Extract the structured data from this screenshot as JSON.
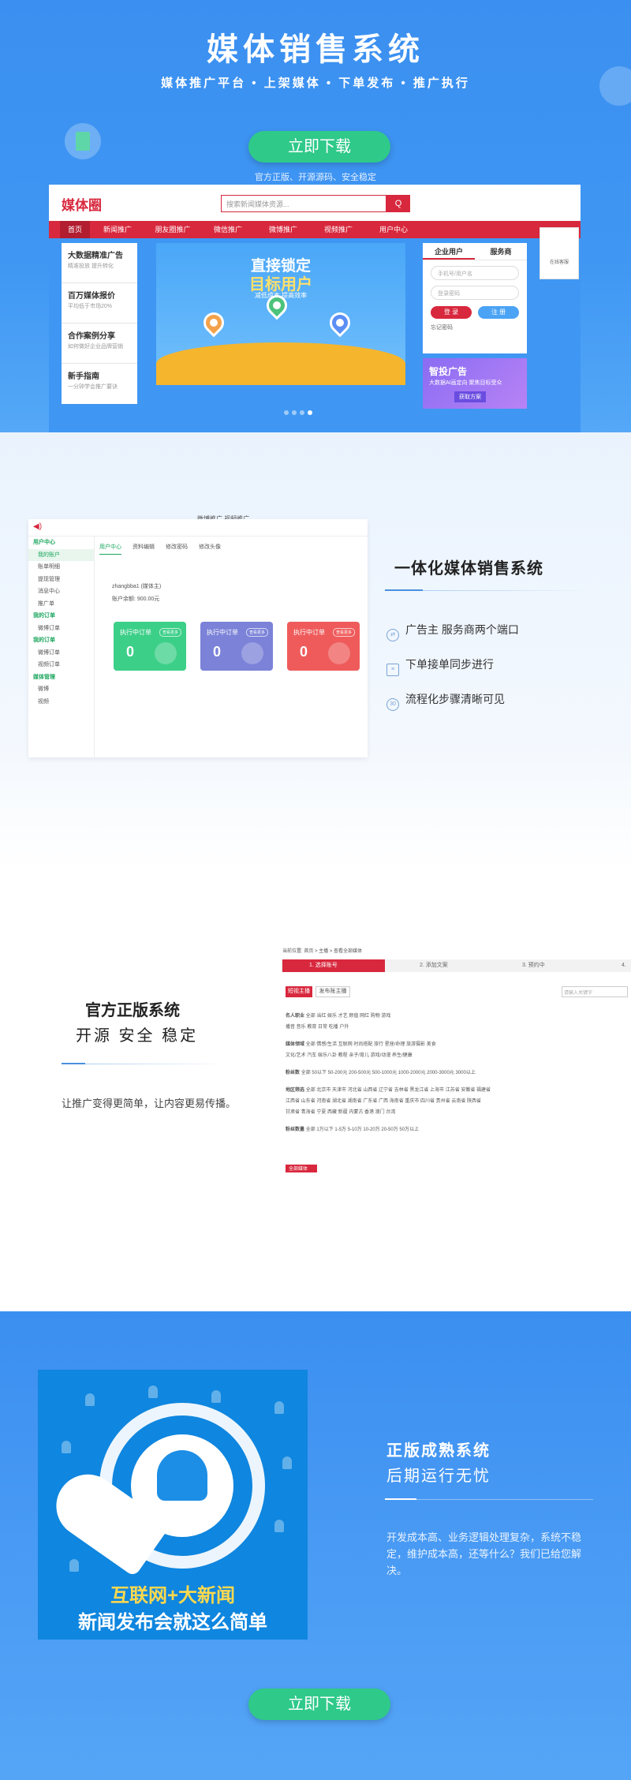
{
  "hero": {
    "title": "媒体销售系统",
    "subtitle": "媒体推广平台 • 上架媒体 • 下单发布 • 推广执行",
    "download_label": "立即下载",
    "note": "官方正版、开源源码、安全稳定"
  },
  "mock_site": {
    "logo": "媒体圈",
    "search_placeholder": "搜索新闻媒体资源...",
    "search_button": "Q",
    "nav": [
      "首页",
      "新闻推广",
      "朋友圈推广",
      "微信推广",
      "微博推广",
      "视频推广",
      "用户中心"
    ],
    "left_cards": [
      {
        "title": "大数据精准广告",
        "desc": "精准投放 提升转化"
      },
      {
        "title": "百万媒体报价",
        "desc": "平均低于市场20%"
      },
      {
        "title": "合作案例分享",
        "desc": "如何做好企业品牌营销"
      },
      {
        "title": "新手指南",
        "desc": "一分钟学会推广要诀"
      }
    ],
    "banner": {
      "line1": "直接锁定",
      "line2": "目标用户",
      "line3": "减低成本  提高效率"
    },
    "login": {
      "tab1": "企业用户",
      "tab2": "服务商",
      "phone_placeholder": "手机号/用户名",
      "password_placeholder": "登录密码",
      "login_button": "登 录",
      "register_button": "注 册",
      "social_label": "忘记密码"
    },
    "promo": {
      "title": "智投广告",
      "desc": "大数据AI画定向 聚焦目标受众",
      "button": "获取方案"
    },
    "side_label": "在线客服"
  },
  "admin": {
    "mini_tabs": "微博推广       视频推广",
    "side_items": [
      {
        "label": "用户中心",
        "group": true
      },
      {
        "label": "我的账户",
        "active": true
      },
      {
        "label": "账单明细"
      },
      {
        "label": "提现管理"
      },
      {
        "label": "消息中心"
      },
      {
        "label": "推广单"
      },
      {
        "label": "我的订单",
        "group": true
      },
      {
        "label": "微博订单"
      },
      {
        "label": "我的订单",
        "group": true
      },
      {
        "label": "微博订单"
      },
      {
        "label": "视频订单"
      },
      {
        "label": "媒体管理",
        "group": true
      },
      {
        "label": "微博"
      },
      {
        "label": "视频"
      }
    ],
    "tabs": [
      "用户中心",
      "资料编辑",
      "修改密码",
      "修改头像"
    ],
    "username": "zhangbba1 (媒体主)",
    "balance": "账户余额: 900.00元",
    "cards": [
      {
        "label": "执行中订单",
        "tag": "查看更多",
        "value": "0",
        "color": "#3ccf88"
      },
      {
        "label": "执行中订单",
        "tag": "查看更多",
        "value": "0",
        "color": "#7b82d8"
      },
      {
        "label": "执行中订单",
        "tag": "查看更多",
        "value": "0",
        "color": "#ef5b5b"
      }
    ]
  },
  "features": {
    "title": "一体化媒体销售系统",
    "items": [
      {
        "icon": "handshake-icon",
        "text": "广告主 服务商两个端口"
      },
      {
        "icon": "document-icon",
        "text": "下单接单同步进行"
      },
      {
        "icon": "timer-icon",
        "text": "流程化步骤清晰可见"
      }
    ]
  },
  "official": {
    "title": "官方正版系统",
    "subtitle": "开源 安全 稳定",
    "desc": "让推广变得更简单，让内容更易传播。"
  },
  "screenshot": {
    "crumb": "当前位置: 首页 > 主播 > 查看全部媒体",
    "steps": [
      "1. 选择账号",
      "2. 添加文案",
      "3. 预约中",
      "4."
    ],
    "btn1": "短视主播",
    "btn2": "发布账主播",
    "search_placeholder": "请输入关键字",
    "rows": [
      {
        "label": "名人职业",
        "text": "全部   当红   娱乐   才艺   颜值   网红   购物   游戏"
      },
      {
        "label": "",
        "text": "           播音   音乐   教育   日常   吃播   户外"
      },
      {
        "label": "媒体领域",
        "text": "全部   情感/生活   互联网   时尚搭配   旅行   星座/命理   旅游摄影   美食"
      },
      {
        "label": "",
        "text": "           文化/艺术   汽车   娱乐八卦   教程   亲子/育儿   游戏/动漫   养生/健康"
      },
      {
        "label": "粉丝数",
        "text": "全部   50以下   50-200元   200-500元   500-1000元   1000-2000元   2000-3000元   3000以上"
      },
      {
        "label": "地区筛选",
        "text": "全部   北京市   天津市   河北省   山西省   辽宁省   吉林省   黑龙江省   上海市   江苏省   安徽省   福建省"
      },
      {
        "label": "",
        "text": "           江西省   山东省   河南省   湖北省   湖南省   广东省   广西   海南省   重庆市   四川省   贵州省   云南省   陕西省"
      },
      {
        "label": "",
        "text": "           甘肃省   青海省   宁夏   西藏   新疆   内蒙古   香港   澳门   台湾"
      },
      {
        "label": "粉丝数量",
        "text": "全部   1万以下   1-5万   5-10万   10-20万   20-50万   50万以上"
      }
    ],
    "footer": "全部媒体"
  },
  "mature": {
    "title": "正版成熟系统",
    "subtitle": "后期运行无忧",
    "desc": "开发成本高、业务逻辑处理复杂，系统不稳定，维护成本高，还等什么？我们已给您解决。",
    "image_line1": "互联网+大新闻",
    "image_line2": "新闻发布会就这么简单",
    "download_label": "立即下载"
  }
}
